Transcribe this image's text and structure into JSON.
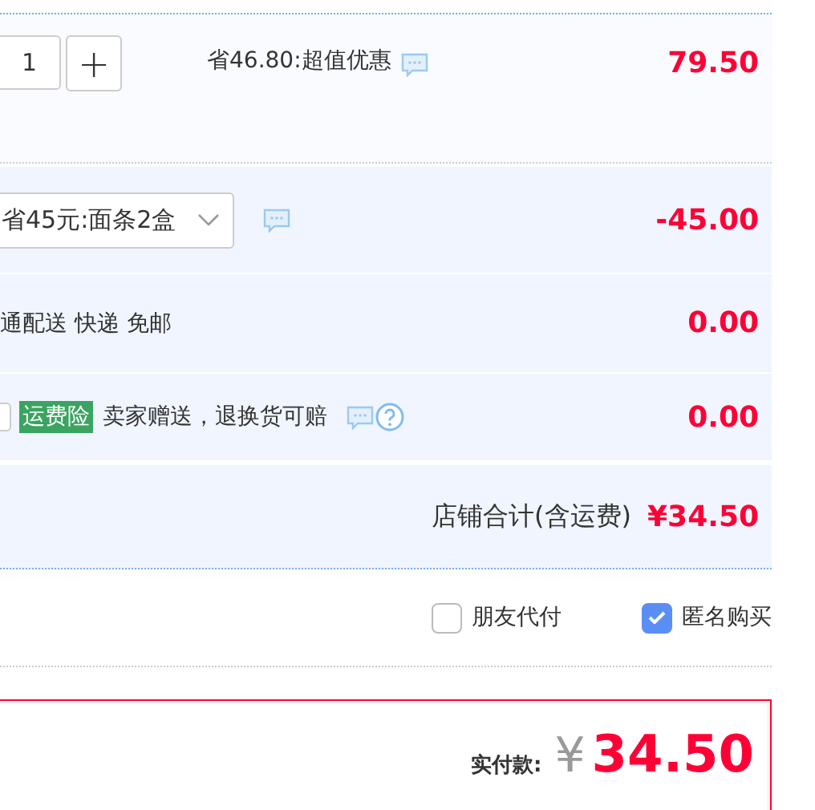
{
  "item": {
    "quantity": "1",
    "plus": "+",
    "promo": "省46.80:超值优惠",
    "price": "79.50"
  },
  "discount": {
    "option": "省45元:面条2盒",
    "amount": "-45.00"
  },
  "shipping": {
    "text": "通配送 快递 免邮",
    "amount": "0.00"
  },
  "insurance": {
    "checked": false,
    "tag": "运费险",
    "text": "卖家赠送，退换货可赔",
    "amount": "0.00"
  },
  "shop_total": {
    "label": "店铺合计(含运费)",
    "amount": "¥34.50"
  },
  "options": [
    {
      "label": "朋友代付",
      "checked": false
    },
    {
      "label": "匿名购买",
      "checked": true
    }
  ],
  "payment": {
    "label": "实付款:",
    "currency": "¥",
    "amount": "34.50"
  }
}
